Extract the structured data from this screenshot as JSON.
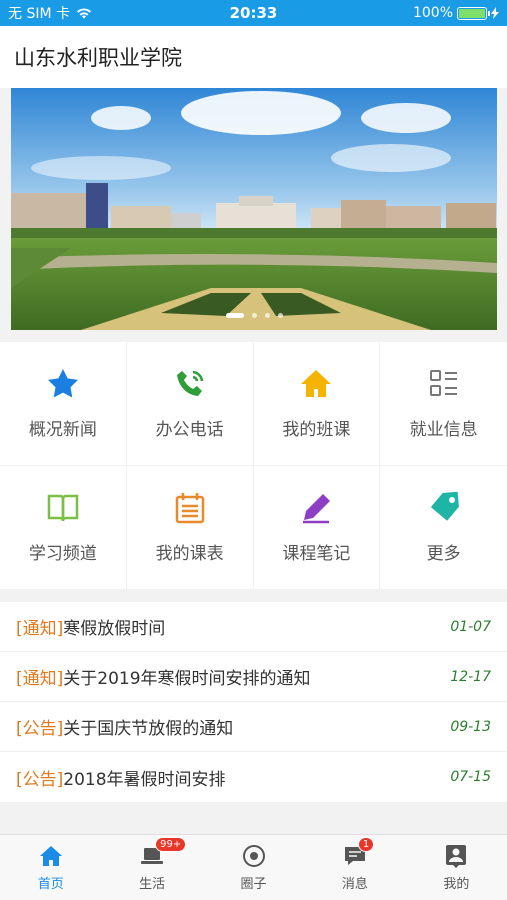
{
  "status_bar": {
    "carrier": "无 SIM 卡",
    "time": "20:33",
    "battery": "100%"
  },
  "header": {
    "title": "山东水利职业学院"
  },
  "banner": {
    "slide_count": 4,
    "active_slide": 1
  },
  "grid": [
    {
      "label": "概况新闻",
      "icon": "star-icon",
      "color": "#1a7fe0"
    },
    {
      "label": "办公电话",
      "icon": "phone-icon",
      "color": "#2e9d3a"
    },
    {
      "label": "我的班课",
      "icon": "home-icon",
      "color": "#f4b400"
    },
    {
      "label": "就业信息",
      "icon": "list-icon",
      "color": "#777777"
    },
    {
      "label": "学习频道",
      "icon": "book-icon",
      "color": "#7cc043"
    },
    {
      "label": "我的课表",
      "icon": "calendar-icon",
      "color": "#e8892b"
    },
    {
      "label": "课程笔记",
      "icon": "pencil-icon",
      "color": "#8e3ec4"
    },
    {
      "label": "更多",
      "icon": "tag-icon",
      "color": "#1fb5a6"
    }
  ],
  "news": [
    {
      "tag": "[通知]",
      "title": "寒假放假时间",
      "date": "01-07"
    },
    {
      "tag": "[通知]",
      "title": "关于2019年寒假时间安排的通知",
      "date": "12-17"
    },
    {
      "tag": "[公告]",
      "title": "关于国庆节放假的通知",
      "date": "09-13"
    },
    {
      "tag": "[公告]",
      "title": "2018年暑假时间安排",
      "date": "07-15"
    }
  ],
  "tabs": [
    {
      "label": "首页",
      "icon": "home-tab-icon",
      "active": true,
      "badge": ""
    },
    {
      "label": "生活",
      "icon": "laptop-tab-icon",
      "active": false,
      "badge": "99+"
    },
    {
      "label": "圈子",
      "icon": "circle-tab-icon",
      "active": false,
      "badge": ""
    },
    {
      "label": "消息",
      "icon": "message-tab-icon",
      "active": false,
      "badge": "1"
    },
    {
      "label": "我的",
      "icon": "profile-tab-icon",
      "active": false,
      "badge": ""
    }
  ]
}
